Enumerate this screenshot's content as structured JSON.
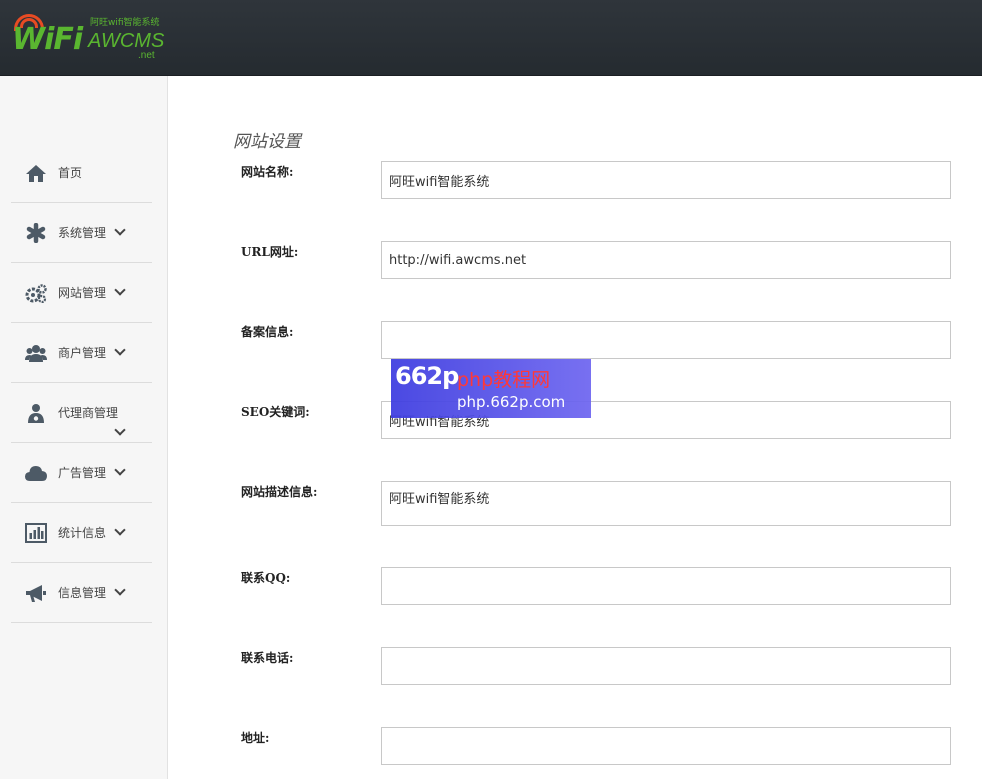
{
  "brand": {
    "tagline": "阿旺wifi智能系统",
    "wifi": "WiFi",
    "awcms": "AWCMS",
    "net": ".net",
    "accent": "#5ab630"
  },
  "sidebar": {
    "items": [
      {
        "label": "首页",
        "icon": "home-icon",
        "has_chevron": false
      },
      {
        "label": "系统管理",
        "icon": "asterisk-icon",
        "has_chevron": true
      },
      {
        "label": "网站管理",
        "icon": "gears-icon",
        "has_chevron": true
      },
      {
        "label": "商户管理",
        "icon": "users-icon",
        "has_chevron": true
      },
      {
        "label": "代理商管理",
        "icon": "user-md-icon",
        "has_chevron": true
      },
      {
        "label": "广告管理",
        "icon": "cloud-icon",
        "has_chevron": true
      },
      {
        "label": "统计信息",
        "icon": "bar-chart-icon",
        "has_chevron": true
      },
      {
        "label": "信息管理",
        "icon": "bullhorn-icon",
        "has_chevron": true
      }
    ]
  },
  "main": {
    "title": "网站设置",
    "fields": [
      {
        "label": "网站名称:",
        "value": "阿旺wifi智能系统"
      },
      {
        "label": "URL网址:",
        "value": "http://wifi.awcms.net"
      },
      {
        "label": "备案信息:",
        "value": ""
      },
      {
        "label": "SEO关键词:",
        "value": "阿旺wifi智能系统"
      },
      {
        "label": "网站描述信息:",
        "value": "阿旺wifi智能系统"
      },
      {
        "label": "联系QQ:",
        "value": ""
      },
      {
        "label": "联系电话:",
        "value": ""
      },
      {
        "label": "地址:",
        "value": ""
      }
    ]
  },
  "watermark": {
    "logo_text": "662p",
    "title": "php教程网",
    "url": "php.662p.com"
  }
}
